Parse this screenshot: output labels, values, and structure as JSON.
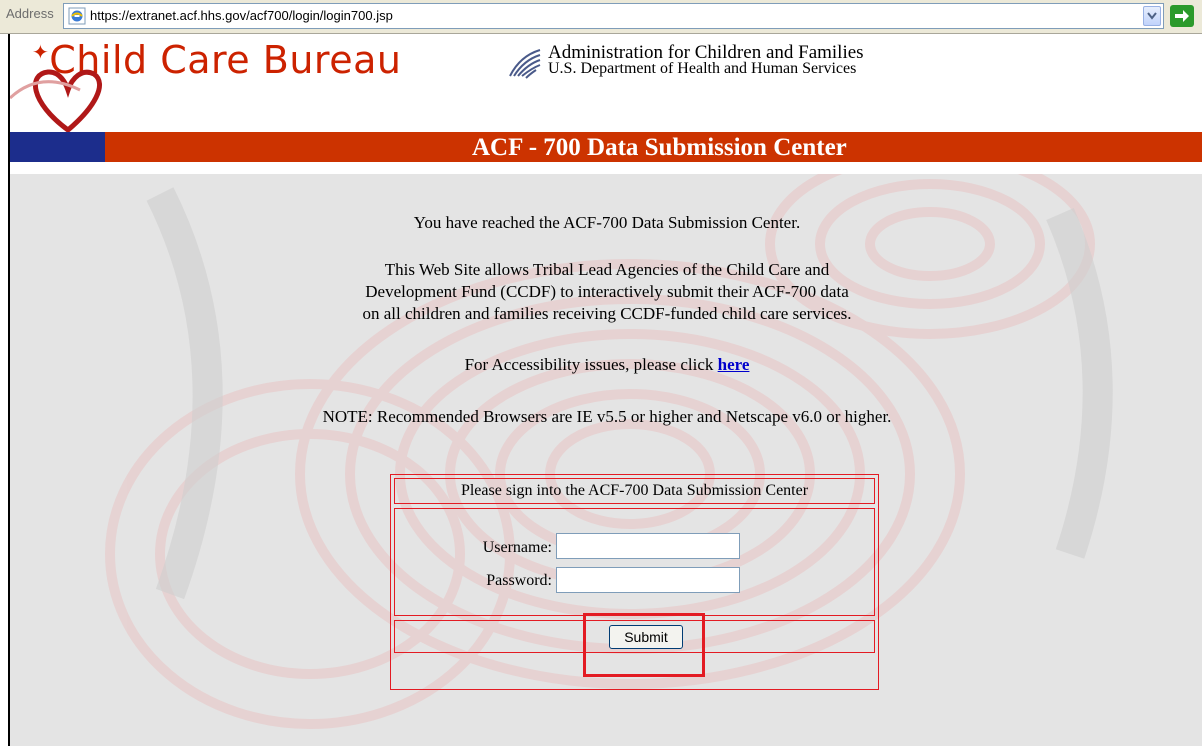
{
  "address_bar": {
    "label": "Address",
    "url": "https://extranet.acf.hhs.gov/acf700/login/login700.jsp"
  },
  "header": {
    "logo_text": "Child Care Bureau",
    "agency_line1": "Administration for Children and Families",
    "agency_line2": "U.S. Department of Health and Human Services",
    "banner_title": "ACF - 700 Data Submission Center"
  },
  "intro": {
    "reached": "You have reached the ACF-700 Data Submission Center.",
    "desc_line1": "This Web Site allows Tribal Lead Agencies of the Child Care and",
    "desc_line2": "Development Fund (CCDF) to interactively submit their ACF-700 data",
    "desc_line3": "on all children and families receiving CCDF-funded child care services.",
    "accessibility_prefix": "For Accessibility issues, please click ",
    "accessibility_link": "here",
    "note": "NOTE: Recommended Browsers are IE v5.5 or higher and Netscape v6.0 or higher."
  },
  "login": {
    "heading": "Please sign into the ACF-700 Data Submission Center",
    "username_label": "Username:",
    "username_value": "",
    "password_label": "Password:",
    "password_value": "",
    "submit_label": "Submit"
  },
  "colors": {
    "banner": "#cc3300",
    "banner_left": "#1c2d8c",
    "logo": "#cc2200",
    "table_border": "#e31b23",
    "link": "#0000cc"
  }
}
